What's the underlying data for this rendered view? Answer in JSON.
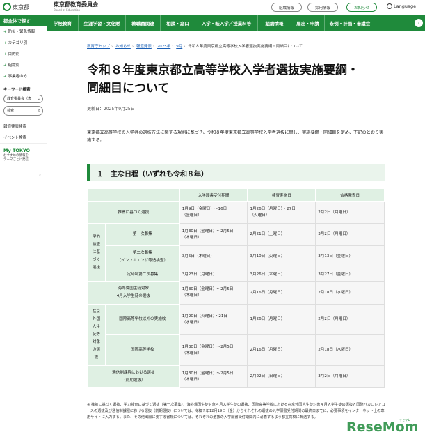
{
  "header": {
    "logo_text": "東京都",
    "board_name": "東京都教育委員会",
    "board_sub": "Board of Education",
    "buttons": [
      "組織情報",
      "採用情報",
      "お知らせ"
    ],
    "language": "Language"
  },
  "nav": {
    "items": [
      "学校教育",
      "生涯学習・文化財",
      "教職員関連",
      "相談・窓口",
      "入学・転入学／授業料等",
      "組織情報",
      "届出・申請",
      "条例・計画・審議会"
    ]
  },
  "sidebar": {
    "head": "都全体で探す",
    "items": [
      "防災・緊急情報",
      "カテゴリ別",
      "目的別",
      "組織別",
      "事業者の方"
    ],
    "keyword_label": "キーワード検索",
    "select_value": "教育委員会（表",
    "search_placeholder": "検索",
    "links": [
      "報道発表検索",
      "イベント検索"
    ],
    "mytokyo_logo": "My TOKYO",
    "mytokyo_desc1": "おすすめの情報を",
    "mytokyo_desc2": "テーマごとに発信"
  },
  "breadcrumb": [
    "教育庁トップ",
    "お知らせ",
    "報道発表",
    "2025年",
    "9月",
    "令和８年度東京都立高等学校入学者選抜実施要綱・同細目について"
  ],
  "page": {
    "title_line1": "令和８年度東京都立高等学校入学者選抜実施要綱・",
    "title_line2": "同細目について",
    "updated": "更新日：2025年9月25日",
    "intro": "東京都立高等学校の入学者の選抜方法に関する規則に基づき、令和８年度東京都立高等学校入学者選抜に関し、実施要綱・同細目を定め、下記のとおり実施する。",
    "section_title": "１　主な日程（いずれも令和８年）"
  },
  "table": {
    "headers": [
      "入学願書受付期間",
      "検査実施日",
      "合格発表日"
    ],
    "rows": [
      {
        "cat": "推薦に基づく選抜",
        "period1": "1月9日（金曜日）～16日",
        "period2": "（金曜日）",
        "exam1": "1月26日（月曜日）・27日",
        "exam2": "（火曜日）",
        "result": "2月2日（月曜日）"
      },
      {
        "cat": "第一次募集",
        "period1": "1月30日（金曜日）～2月5日",
        "period2": "（木曜日）",
        "exam1": "2月21日（土曜日）",
        "exam2": "",
        "result": "3月2日（月曜日）"
      },
      {
        "cat": "第二次募集",
        "cat2": "（インフルエンザ等追検査）",
        "period1": "3月5日（木曜日）",
        "period2": "",
        "exam1": "3月10日（火曜日）",
        "exam2": "",
        "result": "3月13日（金曜日）"
      },
      {
        "cat": "定時制第二次募集",
        "period1": "3月23日（月曜日）",
        "period2": "",
        "exam1": "3月26日（木曜日）",
        "exam2": "",
        "result": "3月27日（金曜日）"
      },
      {
        "cat": "海外帰国生徒対象",
        "cat2": "4月入学生徒の選抜",
        "period1": "1月30日（金曜日）～2月5日",
        "period2": "（木曜日）",
        "exam1": "2月16日（月曜日）",
        "exam2": "",
        "result": "2月18日（水曜日）"
      },
      {
        "cat": "国際高等学校以外の実施校",
        "period1": "1月20日（火曜日）・21日",
        "period2": "（水曜日）",
        "exam1": "1月26日（月曜日）",
        "exam2": "",
        "result": "2月2日（月曜日）"
      },
      {
        "cat": "国際高等学校",
        "period1": "1月30日（金曜日）～2月5日",
        "period2": "（木曜日）",
        "exam1": "2月16日（月曜日）",
        "exam2": "",
        "result": "2月18日（水曜日）"
      },
      {
        "cat": "通信制課程における選抜",
        "cat2": "（前期選抜）",
        "period1": "1月30日（金曜日）～2月5日",
        "period2": "（木曜日）",
        "exam1": "2月22日（日曜日）",
        "exam2": "",
        "result": "3月2日（月曜日）"
      }
    ],
    "group1": [
      "学力",
      "検査",
      "に基",
      "づく",
      "選抜"
    ],
    "group2": [
      "在京",
      "外国",
      "人生",
      "徒等",
      "対象",
      "の選",
      "抜"
    ]
  },
  "footnote": "※ 推薦に基づく選抜、学力検査に基づく選抜（第一次募集）、海外帰国生徒対象４月入学生徒の選抜、国際高等学校における在京外国人生徒対象４月入学生徒の選抜と国際バカロレアコースの選抜及び通信制課程における選抜（前期選抜）については、令和７年12月19日（金）からそれぞれの選抜の入学願書受付期間の最終日までに、必要事項をインターネット上の専用サイトに入力する。また、その他出願に要する書類については、それぞれの選抜の入学願書受付期間内に必着するよう都立高校に郵送する。",
  "watermark": "ReseMom",
  "watermark_small": "リセマム",
  "colors": {
    "brand_green": "#1f8a3b",
    "table_header": "#dff0e3",
    "link": "#1a5fb4"
  }
}
